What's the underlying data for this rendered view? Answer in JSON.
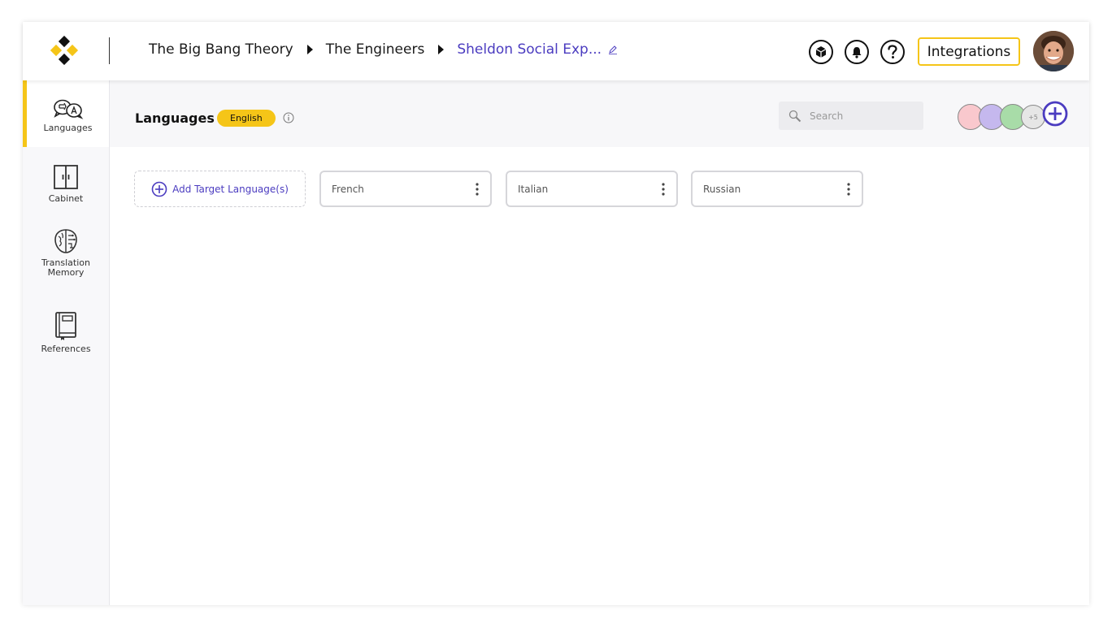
{
  "breadcrumb": {
    "items": [
      "The Big Bang Theory",
      "The Engineers"
    ],
    "current": "Sheldon Social Exp..."
  },
  "topbar": {
    "integrations_label": "Integrations"
  },
  "sidebar": {
    "items": [
      {
        "label": "Languages",
        "icon": "translate-icon"
      },
      {
        "label": "Cabinet",
        "icon": "cabinet-icon"
      },
      {
        "label": "Translation Memory",
        "icon": "brain-icon"
      },
      {
        "label": "References",
        "icon": "book-icon"
      }
    ]
  },
  "subheader": {
    "title": "Languages",
    "source_language": "English",
    "search_placeholder": "Search",
    "extra_members": "+5"
  },
  "languages": {
    "add_label": "Add Target Language(s)",
    "targets": [
      "French",
      "Italian",
      "Russian"
    ]
  },
  "colors": {
    "accent_yellow": "#f5c518",
    "accent_purple": "#4b3cc0",
    "member_colors": [
      "#f9c8cd",
      "#c5b8ee",
      "#a8dca8",
      "#e6e6e6"
    ]
  }
}
